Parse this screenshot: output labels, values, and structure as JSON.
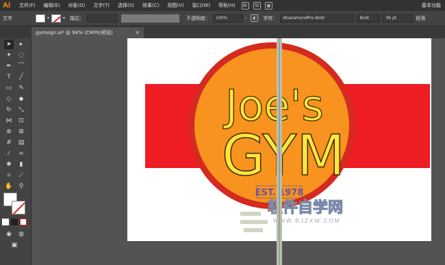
{
  "menubar": {
    "logo": "Ai",
    "items": [
      "文件(F)",
      "编辑(E)",
      "对象(O)",
      "文字(T)",
      "选择(S)",
      "效果(C)",
      "视图(V)",
      "窗口(W)",
      "帮助(H)"
    ],
    "workspace": "基本功能"
  },
  "controlbar": {
    "mode_label": "文字",
    "stroke_label": "描边：",
    "opacity_label": "不透明度：",
    "opacity_value": "100%",
    "char_label": "字符：",
    "font_name": "AGaramondPro Bold",
    "font_style": "Bold",
    "font_size": "36 pt",
    "paragraph_label": "段落"
  },
  "document_tab": {
    "label": "gymsign.ai* @ 94% (CMYK/预览)",
    "close": "×"
  },
  "artwork": {
    "line1": "Joe's",
    "line2": "GYM",
    "est": "EST. 1978",
    "colors": {
      "band": "#ee1c23",
      "circle_outer": "#d42a20",
      "circle_inner": "#f7931e",
      "text_fill": "#ffe53a",
      "text_stroke": "#3a2a10",
      "est_box": "#6a52a0"
    }
  },
  "watermark": {
    "main": "软件自学网",
    "sub": "WWW.RJZXW.COM"
  }
}
